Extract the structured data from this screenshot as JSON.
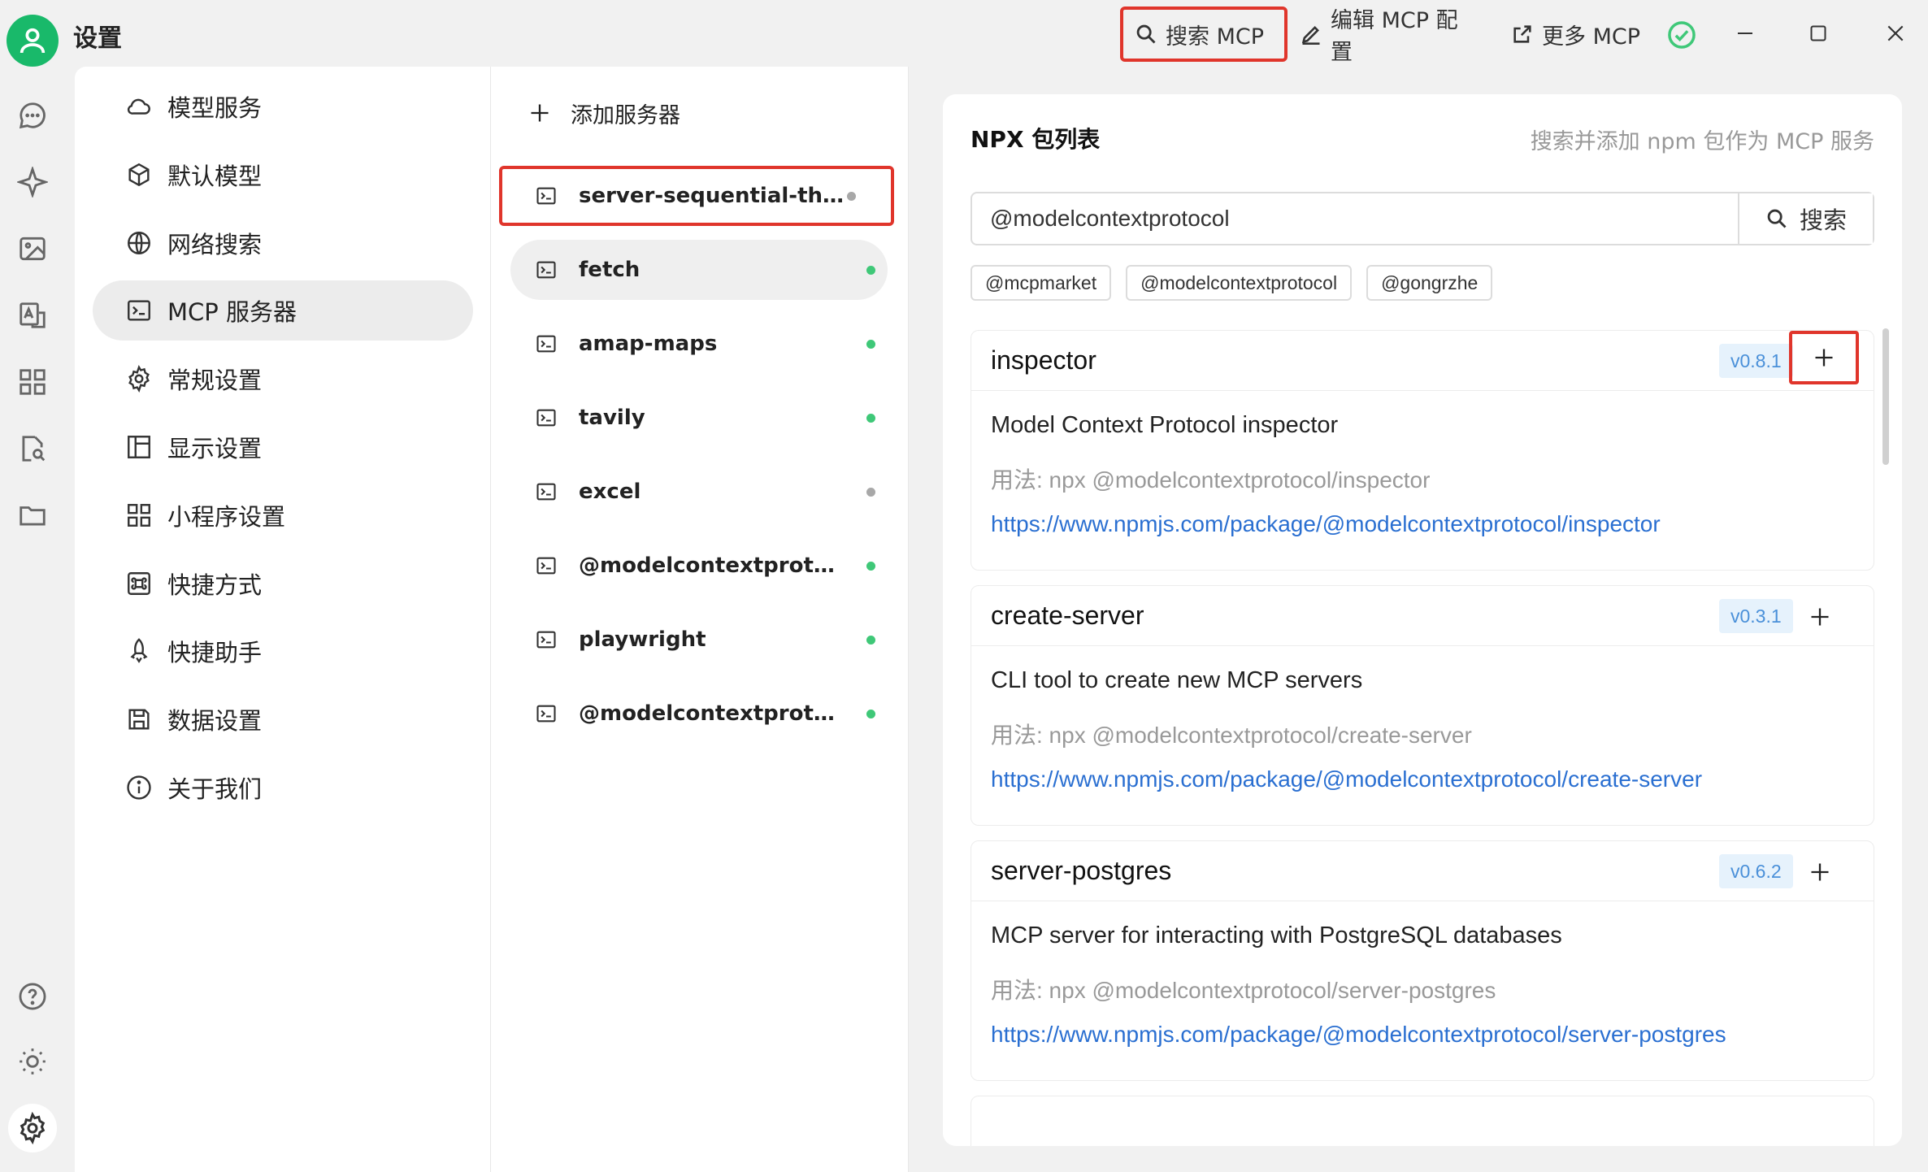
{
  "window": {
    "title": "设置",
    "search_mcp": "搜索 MCP",
    "edit_mcp": "编辑 MCP 配置",
    "more_mcp": "更多 MCP"
  },
  "menu": [
    {
      "label": "模型服务",
      "icon": "cloud-icon"
    },
    {
      "label": "默认模型",
      "icon": "cube-icon"
    },
    {
      "label": "网络搜索",
      "icon": "globe-icon"
    },
    {
      "label": "MCP 服务器",
      "icon": "terminal-icon",
      "active": true
    },
    {
      "label": "常规设置",
      "icon": "gear-icon"
    },
    {
      "label": "显示设置",
      "icon": "layout-icon"
    },
    {
      "label": "小程序设置",
      "icon": "grid-icon"
    },
    {
      "label": "快捷方式",
      "icon": "command-icon"
    },
    {
      "label": "快捷助手",
      "icon": "rocket-icon"
    },
    {
      "label": "数据设置",
      "icon": "save-icon"
    },
    {
      "label": "关于我们",
      "icon": "info-icon"
    }
  ],
  "servers": {
    "add_label": "添加服务器",
    "items": [
      {
        "name": "server-sequential-thinki...",
        "status": "inactive"
      },
      {
        "name": "fetch",
        "status": "active"
      },
      {
        "name": "amap-maps",
        "status": "active"
      },
      {
        "name": "tavily",
        "status": "active"
      },
      {
        "name": "excel",
        "status": "inactive"
      },
      {
        "name": "@modelcontextprotoco...",
        "status": "active"
      },
      {
        "name": "playwright",
        "status": "active"
      },
      {
        "name": "@modelcontextprotoco...",
        "status": "active"
      }
    ]
  },
  "npx": {
    "title": "NPX 包列表",
    "hint": "搜索并添加 npm 包作为 MCP 服务",
    "search_value": "@modelcontextprotocol",
    "search_button": "搜索",
    "tags": [
      "@mcpmarket",
      "@modelcontextprotocol",
      "@gongrzhe"
    ],
    "packages": [
      {
        "name": "inspector",
        "version": "v0.8.1",
        "description": "Model Context Protocol inspector",
        "usage": "用法: npx @modelcontextprotocol/inspector",
        "link": "https://www.npmjs.com/package/@modelcontextprotocol/inspector"
      },
      {
        "name": "create-server",
        "version": "v0.3.1",
        "description": "CLI tool to create new MCP servers",
        "usage": "用法: npx @modelcontextprotocol/create-server",
        "link": "https://www.npmjs.com/package/@modelcontextprotocol/create-server"
      },
      {
        "name": "server-postgres",
        "version": "v0.6.2",
        "description": "MCP server for interacting with PostgreSQL databases",
        "usage": "用法: npx @modelcontextprotocol/server-postgres",
        "link": "https://www.npmjs.com/package/@modelcontextprotocol/server-postgres"
      }
    ]
  },
  "colors": {
    "accent_green": "#19b96a",
    "highlight_red": "#e0352b",
    "status_active": "#3fc878",
    "status_inactive": "#a8a8a8",
    "link_blue": "#2a6fd1",
    "version_bg": "#e6f2fc"
  }
}
